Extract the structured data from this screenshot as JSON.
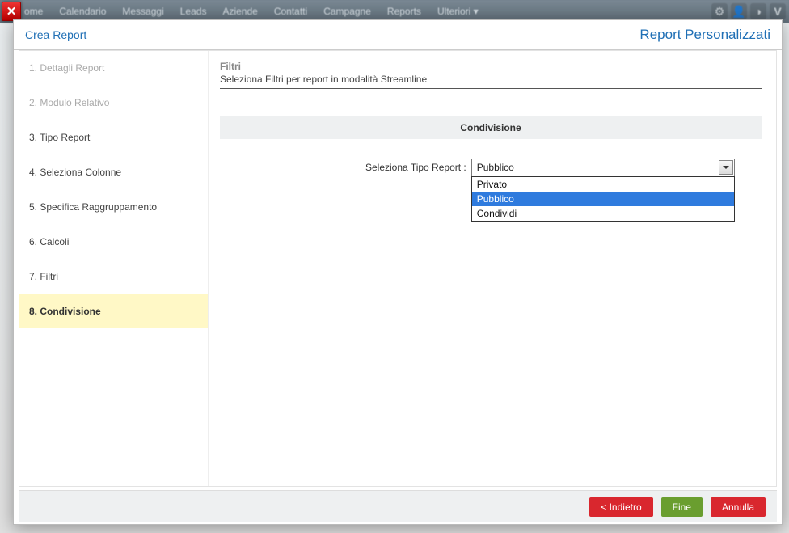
{
  "bg_menu": [
    "ome",
    "Calendario",
    "Messaggi",
    "Leads",
    "Aziende",
    "Contatti",
    "Campagne",
    "Reports",
    "Ulteriori ▾"
  ],
  "close_glyph": "✕",
  "modal": {
    "title": "Crea Report",
    "subtitle": "Report Personalizzati"
  },
  "steps": [
    {
      "label": "1. Dettagli Report",
      "state": "disabled"
    },
    {
      "label": "2. Modulo Relativo",
      "state": "disabled"
    },
    {
      "label": "3. Tipo Report",
      "state": ""
    },
    {
      "label": "4. Seleziona Colonne",
      "state": ""
    },
    {
      "label": "5. Specifica Raggruppamento",
      "state": ""
    },
    {
      "label": "6. Calcoli",
      "state": ""
    },
    {
      "label": "7. Filtri",
      "state": ""
    },
    {
      "label": "8. Condivisione",
      "state": "active"
    }
  ],
  "panel": {
    "head_title": "Filtri",
    "head_sub": "Seleziona Filtri per report in modalità Streamline",
    "section": "Condivisione",
    "field_label": "Seleziona Tipo Report :",
    "selected": "Pubblico",
    "options": [
      {
        "label": "Privato",
        "hl": false
      },
      {
        "label": "Pubblico",
        "hl": true
      },
      {
        "label": "Condividi",
        "hl": false
      }
    ]
  },
  "footer": {
    "back": "< Indietro",
    "finish": "Fine",
    "cancel": "Annulla"
  }
}
